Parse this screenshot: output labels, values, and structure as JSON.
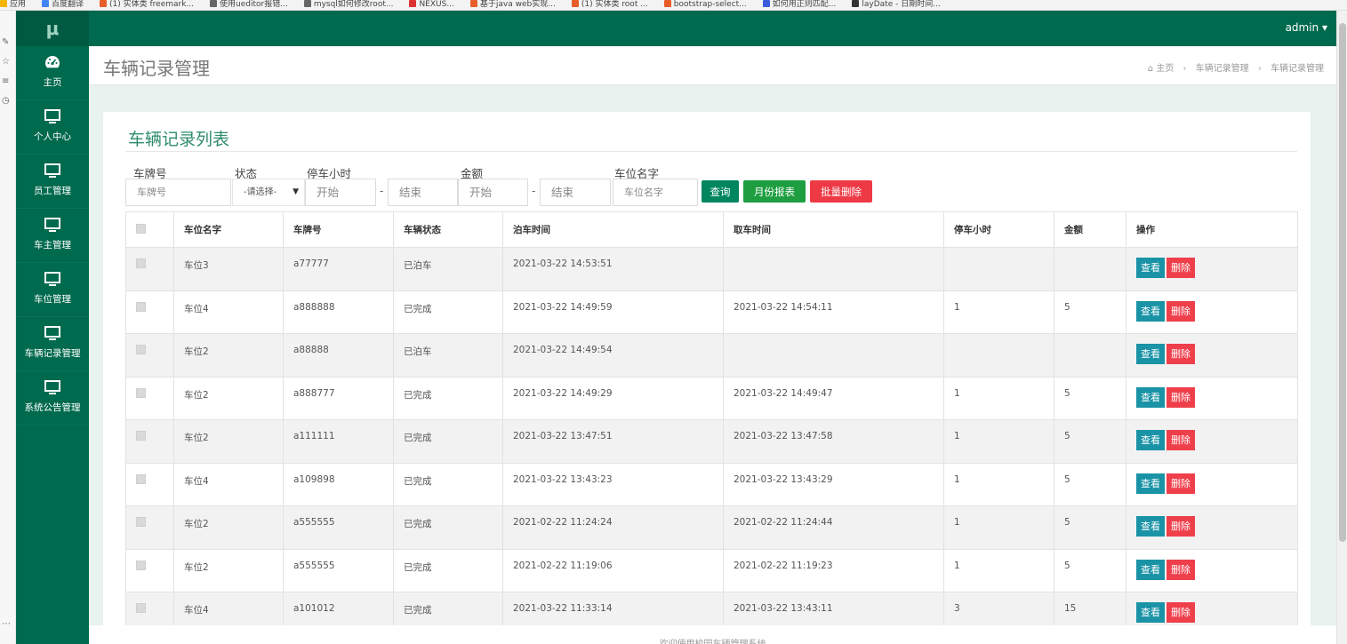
{
  "browser": {
    "bookmarks": [
      "应用",
      "百度翻译",
      "(1) 实体类 freemark...",
      "使用ueditor报错...",
      "mysql如何修改root...",
      "NEXUS...",
      "基于java web实现...",
      "(1) 实体类 root ...",
      "bootstrap-select...",
      "如何用正则匹配...",
      "layDate - 日期时间..."
    ]
  },
  "colors": {
    "sidebar": "#006a4e",
    "accent": "#2f8c6f",
    "danger": "#ef3f4b",
    "info": "#1a93a6"
  },
  "sidebar": {
    "logo": "μ",
    "items": [
      {
        "label": "主页",
        "icon": "dashboard-icon"
      },
      {
        "label": "个人中心",
        "icon": "monitor-icon"
      },
      {
        "label": "员工管理",
        "icon": "monitor-icon"
      },
      {
        "label": "车主管理",
        "icon": "monitor-icon"
      },
      {
        "label": "车位管理",
        "icon": "monitor-icon"
      },
      {
        "label": "车辆记录管理",
        "icon": "monitor-icon"
      },
      {
        "label": "系统公告管理",
        "icon": "monitor-icon"
      }
    ]
  },
  "topbar": {
    "user": "admin ▾"
  },
  "header": {
    "title": "车辆记录管理",
    "breadcrumb": {
      "home": "主页",
      "level1": "车辆记录管理",
      "level2": "车辆记录管理"
    }
  },
  "panel": {
    "title": "车辆记录列表",
    "filters": {
      "plate_label": "车牌号",
      "plate_placeholder": "车牌号",
      "status_label": "状态",
      "status_value": "-请选择-",
      "hours_label": "停车小时",
      "hours_start_placeholder": "开始",
      "hours_end_placeholder": "结束",
      "amount_label": "金额",
      "amount_start_placeholder": "开始",
      "amount_end_placeholder": "结束",
      "spot_label": "车位名字",
      "spot_placeholder": "车位名字",
      "dash": "-"
    },
    "buttons": {
      "query": "查询",
      "monthly": "月份报表",
      "batch_delete": "批量删除"
    }
  },
  "table": {
    "headers": [
      "车位名字",
      "车牌号",
      "车辆状态",
      "泊车时间",
      "取车时间",
      "停车小时",
      "金额",
      "操作"
    ],
    "view_label": "查看",
    "delete_label": "删除",
    "rows": [
      {
        "spot": "车位3",
        "plate": "a77777",
        "status": "已泊车",
        "park_time": "2021-03-22 14:53:51",
        "pickup_time": "",
        "hours": "",
        "amount": ""
      },
      {
        "spot": "车位4",
        "plate": "a888888",
        "status": "已完成",
        "park_time": "2021-03-22 14:49:59",
        "pickup_time": "2021-03-22 14:54:11",
        "hours": "1",
        "amount": "5"
      },
      {
        "spot": "车位2",
        "plate": "a88888",
        "status": "已泊车",
        "park_time": "2021-03-22 14:49:54",
        "pickup_time": "",
        "hours": "",
        "amount": ""
      },
      {
        "spot": "车位2",
        "plate": "a888777",
        "status": "已完成",
        "park_time": "2021-03-22 14:49:29",
        "pickup_time": "2021-03-22 14:49:47",
        "hours": "1",
        "amount": "5"
      },
      {
        "spot": "车位2",
        "plate": "a111111",
        "status": "已完成",
        "park_time": "2021-03-22 13:47:51",
        "pickup_time": "2021-03-22 13:47:58",
        "hours": "1",
        "amount": "5"
      },
      {
        "spot": "车位4",
        "plate": "a109898",
        "status": "已完成",
        "park_time": "2021-03-22 13:43:23",
        "pickup_time": "2021-03-22 13:43:29",
        "hours": "1",
        "amount": "5"
      },
      {
        "spot": "车位2",
        "plate": "a555555",
        "status": "已完成",
        "park_time": "2021-02-22 11:24:24",
        "pickup_time": "2021-02-22 11:24:44",
        "hours": "1",
        "amount": "5"
      },
      {
        "spot": "车位2",
        "plate": "a555555",
        "status": "已完成",
        "park_time": "2021-02-22 11:19:06",
        "pickup_time": "2021-02-22 11:19:23",
        "hours": "1",
        "amount": "5"
      },
      {
        "spot": "车位4",
        "plate": "a101012",
        "status": "已完成",
        "park_time": "2021-03-22 11:33:14",
        "pickup_time": "2021-03-22 13:43:11",
        "hours": "3",
        "amount": "15"
      }
    ]
  },
  "footer": {
    "text": "欢迎使用校园车辆管理系统"
  }
}
